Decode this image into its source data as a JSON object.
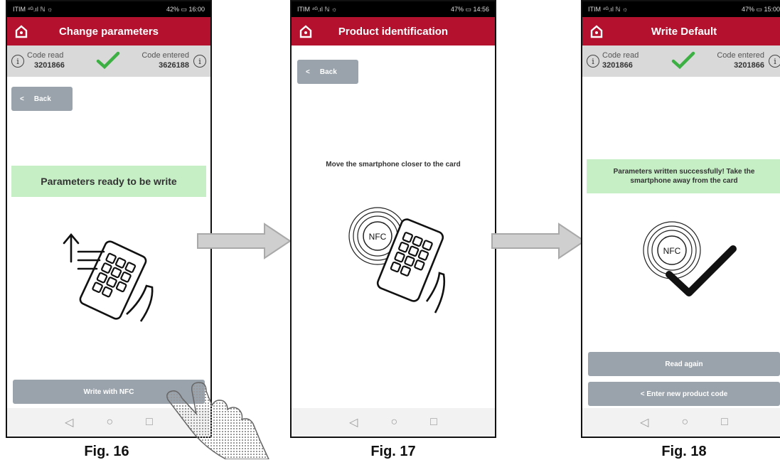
{
  "colors": {
    "header": "#b3112e",
    "green_box": "#c6efc6",
    "button": "#9aa3ac",
    "check": "#3cb043"
  },
  "screens": [
    {
      "status": {
        "left": "ITIM ⁴ᴳ.ıl ℕ ☼",
        "right": "42% ▭ 16:00"
      },
      "title": "Change parameters",
      "code_read_label": "Code read",
      "code_read_value": "3201866",
      "code_entered_label": "Code entered",
      "code_entered_value": "3626188",
      "back_label": "Back",
      "message": "Parameters ready to be write",
      "button_label": "Write with NFC",
      "caption": "Fig. 16"
    },
    {
      "status": {
        "left": "ITIM ⁴ᴳ.ıl ℕ ☼",
        "right": "47% ▭ 14:56"
      },
      "title": "Product identification",
      "back_label": "Back",
      "message": "Move the smartphone closer to the card",
      "nfc_label": "NFC",
      "caption": "Fig. 17"
    },
    {
      "status": {
        "left": "ITIM ⁴ᴳ.ıl ℕ ☼",
        "right": "47% ▭ 15:00"
      },
      "title": "Write Default",
      "code_read_label": "Code read",
      "code_read_value": "3201866",
      "code_entered_label": "Code entered",
      "code_entered_value": "3201866",
      "message": "Parameters written successfully! Take the smartphone away from the card",
      "nfc_label": "NFC",
      "read_again_label": "Read again",
      "new_code_label": "< Enter new product code",
      "caption": "Fig. 18"
    }
  ],
  "nav": {
    "back": "◁",
    "home": "○",
    "recent": "□"
  }
}
